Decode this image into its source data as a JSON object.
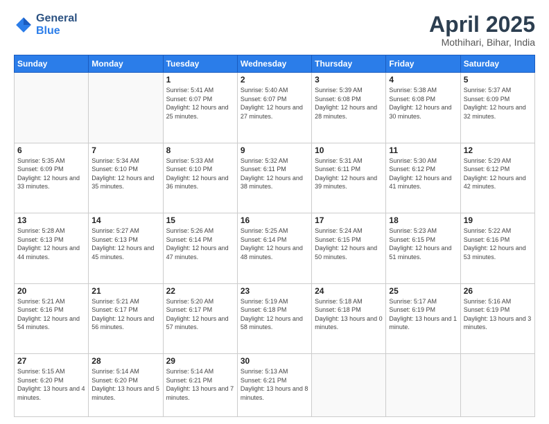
{
  "header": {
    "logo_general": "General",
    "logo_blue": "Blue",
    "title": "April 2025",
    "location": "Mothihari, Bihar, India"
  },
  "weekdays": [
    "Sunday",
    "Monday",
    "Tuesday",
    "Wednesday",
    "Thursday",
    "Friday",
    "Saturday"
  ],
  "weeks": [
    [
      {
        "day": "",
        "sunrise": "",
        "sunset": "",
        "daylight": ""
      },
      {
        "day": "",
        "sunrise": "",
        "sunset": "",
        "daylight": ""
      },
      {
        "day": "1",
        "sunrise": "Sunrise: 5:41 AM",
        "sunset": "Sunset: 6:07 PM",
        "daylight": "Daylight: 12 hours and 25 minutes."
      },
      {
        "day": "2",
        "sunrise": "Sunrise: 5:40 AM",
        "sunset": "Sunset: 6:07 PM",
        "daylight": "Daylight: 12 hours and 27 minutes."
      },
      {
        "day": "3",
        "sunrise": "Sunrise: 5:39 AM",
        "sunset": "Sunset: 6:08 PM",
        "daylight": "Daylight: 12 hours and 28 minutes."
      },
      {
        "day": "4",
        "sunrise": "Sunrise: 5:38 AM",
        "sunset": "Sunset: 6:08 PM",
        "daylight": "Daylight: 12 hours and 30 minutes."
      },
      {
        "day": "5",
        "sunrise": "Sunrise: 5:37 AM",
        "sunset": "Sunset: 6:09 PM",
        "daylight": "Daylight: 12 hours and 32 minutes."
      }
    ],
    [
      {
        "day": "6",
        "sunrise": "Sunrise: 5:35 AM",
        "sunset": "Sunset: 6:09 PM",
        "daylight": "Daylight: 12 hours and 33 minutes."
      },
      {
        "day": "7",
        "sunrise": "Sunrise: 5:34 AM",
        "sunset": "Sunset: 6:10 PM",
        "daylight": "Daylight: 12 hours and 35 minutes."
      },
      {
        "day": "8",
        "sunrise": "Sunrise: 5:33 AM",
        "sunset": "Sunset: 6:10 PM",
        "daylight": "Daylight: 12 hours and 36 minutes."
      },
      {
        "day": "9",
        "sunrise": "Sunrise: 5:32 AM",
        "sunset": "Sunset: 6:11 PM",
        "daylight": "Daylight: 12 hours and 38 minutes."
      },
      {
        "day": "10",
        "sunrise": "Sunrise: 5:31 AM",
        "sunset": "Sunset: 6:11 PM",
        "daylight": "Daylight: 12 hours and 39 minutes."
      },
      {
        "day": "11",
        "sunrise": "Sunrise: 5:30 AM",
        "sunset": "Sunset: 6:12 PM",
        "daylight": "Daylight: 12 hours and 41 minutes."
      },
      {
        "day": "12",
        "sunrise": "Sunrise: 5:29 AM",
        "sunset": "Sunset: 6:12 PM",
        "daylight": "Daylight: 12 hours and 42 minutes."
      }
    ],
    [
      {
        "day": "13",
        "sunrise": "Sunrise: 5:28 AM",
        "sunset": "Sunset: 6:13 PM",
        "daylight": "Daylight: 12 hours and 44 minutes."
      },
      {
        "day": "14",
        "sunrise": "Sunrise: 5:27 AM",
        "sunset": "Sunset: 6:13 PM",
        "daylight": "Daylight: 12 hours and 45 minutes."
      },
      {
        "day": "15",
        "sunrise": "Sunrise: 5:26 AM",
        "sunset": "Sunset: 6:14 PM",
        "daylight": "Daylight: 12 hours and 47 minutes."
      },
      {
        "day": "16",
        "sunrise": "Sunrise: 5:25 AM",
        "sunset": "Sunset: 6:14 PM",
        "daylight": "Daylight: 12 hours and 48 minutes."
      },
      {
        "day": "17",
        "sunrise": "Sunrise: 5:24 AM",
        "sunset": "Sunset: 6:15 PM",
        "daylight": "Daylight: 12 hours and 50 minutes."
      },
      {
        "day": "18",
        "sunrise": "Sunrise: 5:23 AM",
        "sunset": "Sunset: 6:15 PM",
        "daylight": "Daylight: 12 hours and 51 minutes."
      },
      {
        "day": "19",
        "sunrise": "Sunrise: 5:22 AM",
        "sunset": "Sunset: 6:16 PM",
        "daylight": "Daylight: 12 hours and 53 minutes."
      }
    ],
    [
      {
        "day": "20",
        "sunrise": "Sunrise: 5:21 AM",
        "sunset": "Sunset: 6:16 PM",
        "daylight": "Daylight: 12 hours and 54 minutes."
      },
      {
        "day": "21",
        "sunrise": "Sunrise: 5:21 AM",
        "sunset": "Sunset: 6:17 PM",
        "daylight": "Daylight: 12 hours and 56 minutes."
      },
      {
        "day": "22",
        "sunrise": "Sunrise: 5:20 AM",
        "sunset": "Sunset: 6:17 PM",
        "daylight": "Daylight: 12 hours and 57 minutes."
      },
      {
        "day": "23",
        "sunrise": "Sunrise: 5:19 AM",
        "sunset": "Sunset: 6:18 PM",
        "daylight": "Daylight: 12 hours and 58 minutes."
      },
      {
        "day": "24",
        "sunrise": "Sunrise: 5:18 AM",
        "sunset": "Sunset: 6:18 PM",
        "daylight": "Daylight: 13 hours and 0 minutes."
      },
      {
        "day": "25",
        "sunrise": "Sunrise: 5:17 AM",
        "sunset": "Sunset: 6:19 PM",
        "daylight": "Daylight: 13 hours and 1 minute."
      },
      {
        "day": "26",
        "sunrise": "Sunrise: 5:16 AM",
        "sunset": "Sunset: 6:19 PM",
        "daylight": "Daylight: 13 hours and 3 minutes."
      }
    ],
    [
      {
        "day": "27",
        "sunrise": "Sunrise: 5:15 AM",
        "sunset": "Sunset: 6:20 PM",
        "daylight": "Daylight: 13 hours and 4 minutes."
      },
      {
        "day": "28",
        "sunrise": "Sunrise: 5:14 AM",
        "sunset": "Sunset: 6:20 PM",
        "daylight": "Daylight: 13 hours and 5 minutes."
      },
      {
        "day": "29",
        "sunrise": "Sunrise: 5:14 AM",
        "sunset": "Sunset: 6:21 PM",
        "daylight": "Daylight: 13 hours and 7 minutes."
      },
      {
        "day": "30",
        "sunrise": "Sunrise: 5:13 AM",
        "sunset": "Sunset: 6:21 PM",
        "daylight": "Daylight: 13 hours and 8 minutes."
      },
      {
        "day": "",
        "sunrise": "",
        "sunset": "",
        "daylight": ""
      },
      {
        "day": "",
        "sunrise": "",
        "sunset": "",
        "daylight": ""
      },
      {
        "day": "",
        "sunrise": "",
        "sunset": "",
        "daylight": ""
      }
    ]
  ]
}
